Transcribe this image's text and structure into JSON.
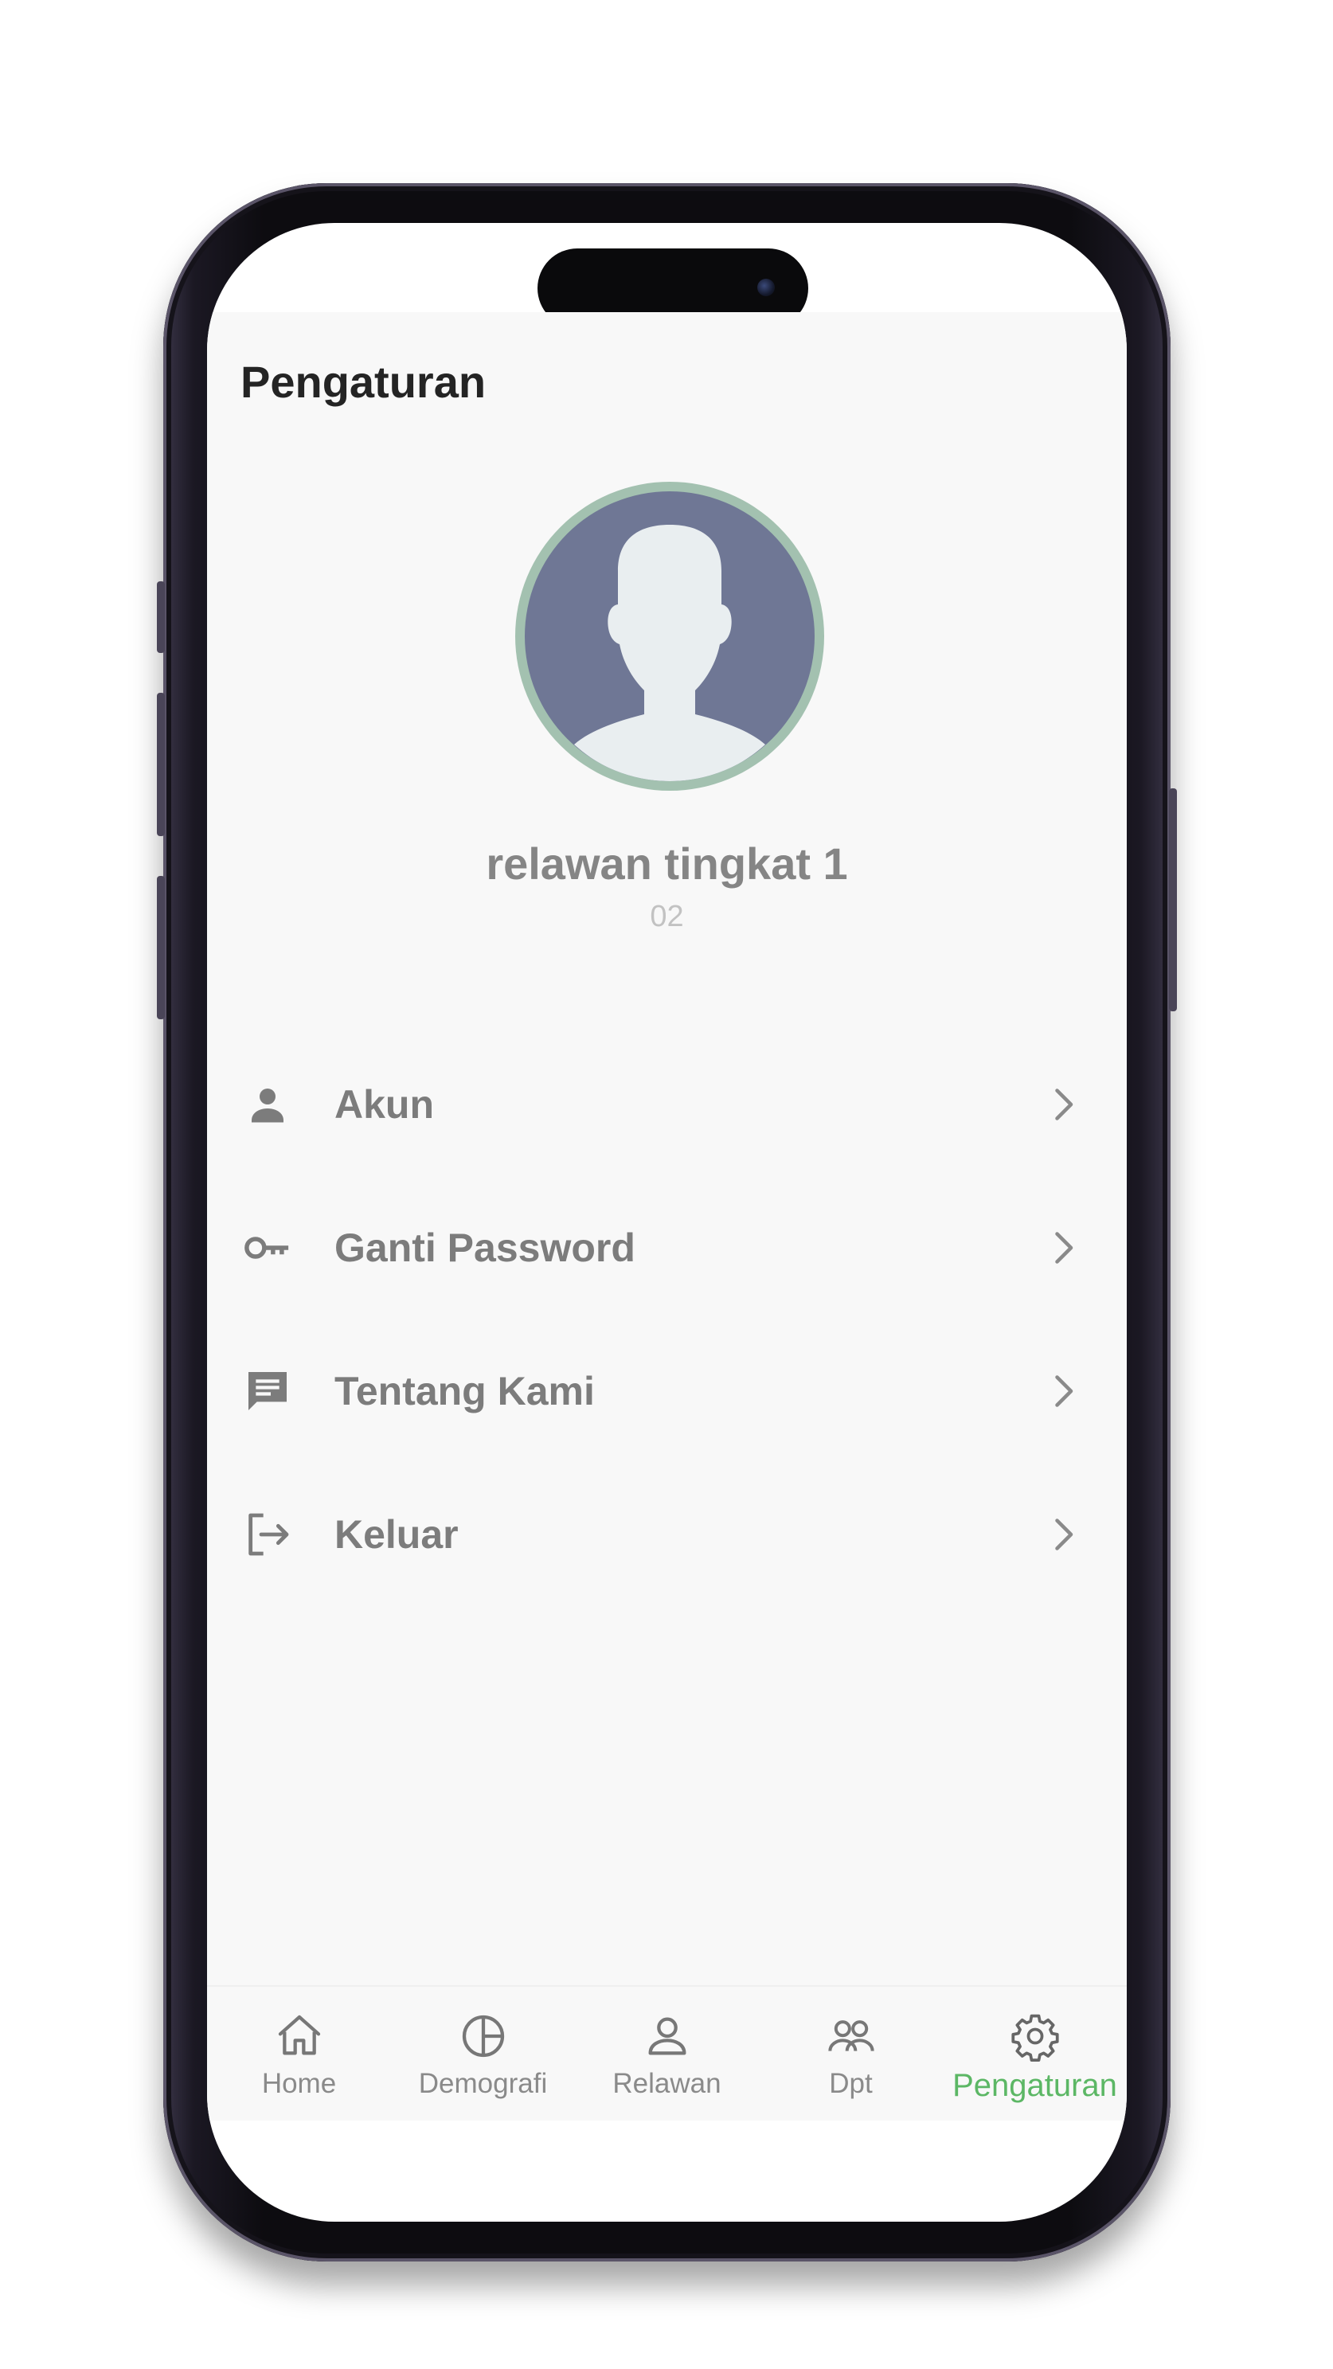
{
  "header": {
    "title": "Pengaturan"
  },
  "profile": {
    "name": "relawan tingkat 1",
    "subtitle": "02",
    "avatar_icon": "user-silhouette-icon"
  },
  "menu": {
    "items": [
      {
        "label": "Akun",
        "icon": "person-icon"
      },
      {
        "label": "Ganti Password",
        "icon": "key-icon"
      },
      {
        "label": "Tentang Kami",
        "icon": "message-icon"
      },
      {
        "label": "Keluar",
        "icon": "logout-icon"
      }
    ]
  },
  "bottom_nav": {
    "active": "Pengaturan",
    "items": [
      {
        "label": "Home",
        "icon": "home-icon"
      },
      {
        "label": "Demografi",
        "icon": "pie-chart-icon"
      },
      {
        "label": "Relawan",
        "icon": "user-icon"
      },
      {
        "label": "Dpt",
        "icon": "users-icon"
      },
      {
        "label": "Pengaturan",
        "icon": "gear-icon"
      }
    ]
  },
  "colors": {
    "accent": "#5cb765",
    "background": "#f8f8f8",
    "avatar_ring": "#a3c1b0",
    "avatar_bg": "#6f7795"
  }
}
